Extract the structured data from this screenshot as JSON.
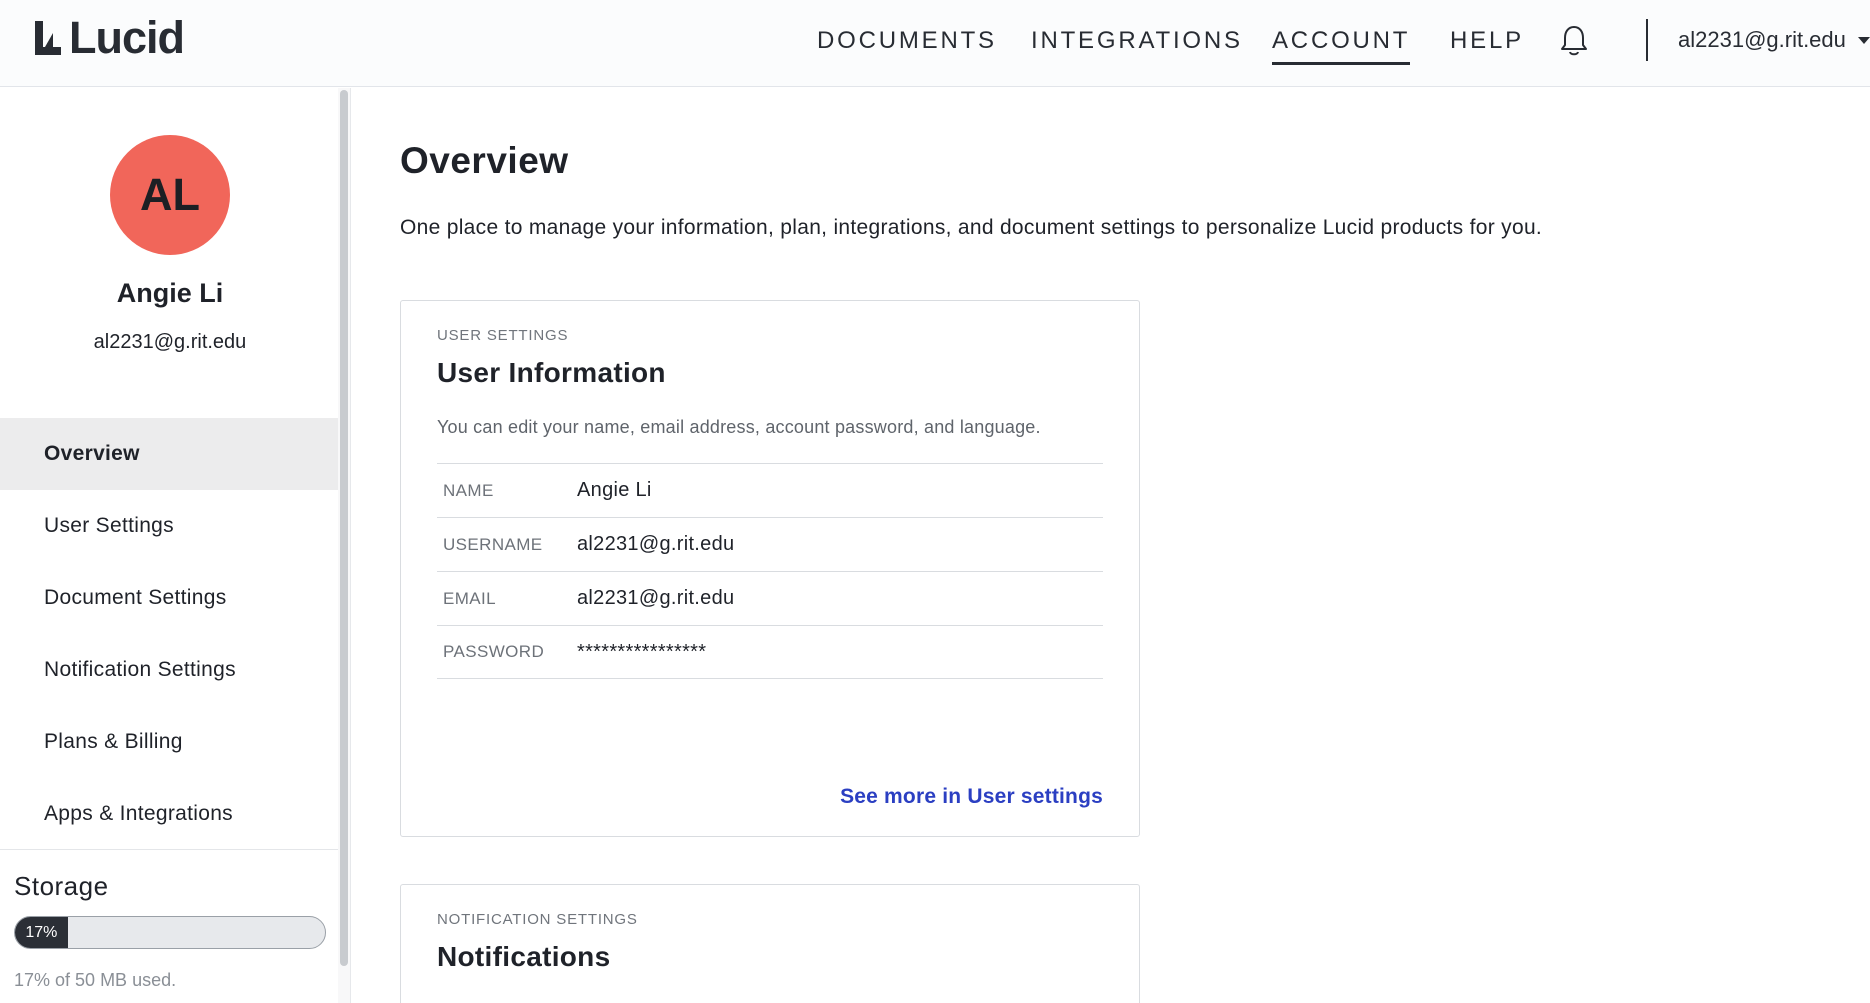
{
  "header": {
    "logo_text": "Lucid",
    "nav": {
      "documents": "DOCUMENTS",
      "integrations": "INTEGRATIONS",
      "account": "ACCOUNT",
      "help": "HELP"
    },
    "active_nav": "account",
    "user_menu_label": "al2231@g.rit.edu"
  },
  "sidebar": {
    "avatar_initials": "AL",
    "avatar_color": "#f1665a",
    "profile_name": "Angie Li",
    "profile_email": "al2231@g.rit.edu",
    "items": [
      {
        "label": "Overview",
        "active": true
      },
      {
        "label": "User Settings",
        "active": false
      },
      {
        "label": "Document Settings",
        "active": false
      },
      {
        "label": "Notification Settings",
        "active": false
      },
      {
        "label": "Plans & Billing",
        "active": false
      },
      {
        "label": "Apps & Integrations",
        "active": false
      }
    ],
    "storage": {
      "title": "Storage",
      "percent_label": "17%",
      "used_fraction": 0.17,
      "caption": "17% of 50 MB used."
    }
  },
  "main": {
    "title": "Overview",
    "description": "One place to manage your information, plan, integrations, and document settings to personalize Lucid products for you.",
    "user_card": {
      "eyebrow": "USER SETTINGS",
      "title": "User Information",
      "description": "You can edit your name, email address, account password, and language.",
      "rows": [
        {
          "label": "NAME",
          "value": "Angie Li"
        },
        {
          "label": "USERNAME",
          "value": "al2231@g.rit.edu"
        },
        {
          "label": "EMAIL",
          "value": "al2231@g.rit.edu"
        },
        {
          "label": "PASSWORD",
          "value": "****************"
        }
      ],
      "link": "See more in User settings"
    },
    "notification_card": {
      "eyebrow": "NOTIFICATION SETTINGS",
      "title": "Notifications"
    }
  },
  "colors": {
    "accent_link": "#2b3fc2",
    "avatar": "#f1665a",
    "storage_fill": "#2b2f36"
  }
}
